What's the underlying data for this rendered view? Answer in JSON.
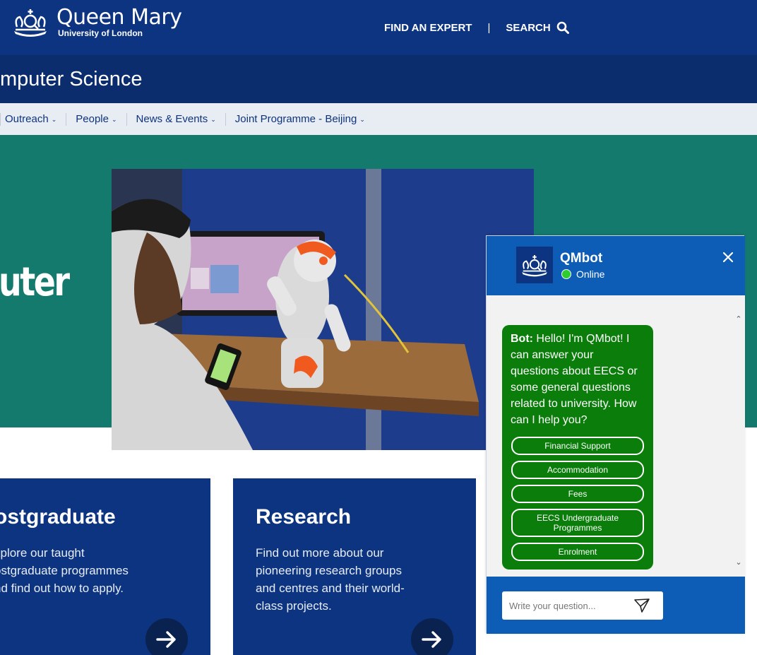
{
  "header": {
    "logo_main": "Queen Mary",
    "logo_sub": "University of London",
    "find_expert": "FIND AN EXPERT",
    "separator": "|",
    "search": "SEARCH"
  },
  "section": {
    "title": "mputer Science"
  },
  "nav": {
    "items": [
      {
        "label": "Outreach"
      },
      {
        "label": "People"
      },
      {
        "label": "News & Events"
      },
      {
        "label": "Joint Programme - Beijing"
      }
    ]
  },
  "hero": {
    "word": "uter"
  },
  "cards": [
    {
      "title": "ostgraduate",
      "lines": [
        "xplore our taught",
        "ostgraduate programmes",
        "nd find out how to apply."
      ]
    },
    {
      "title": "Research",
      "lines": [
        "Find out more about our",
        "pioneering research groups",
        "and centres and their world-",
        "class projects."
      ]
    }
  ],
  "chat": {
    "bot_name": "QMbot",
    "status": "Online",
    "message_prefix": "Bot:",
    "message": " Hello! I'm QMbot! I can answer your questions about EECS or some general questions related to university. How can I help you?",
    "options": [
      {
        "label": "Financial Support"
      },
      {
        "label": "Accommodation"
      },
      {
        "label": "Fees"
      },
      {
        "label": "EECS Undergraduate Programmes"
      },
      {
        "label": "Enrolment"
      }
    ],
    "input_placeholder": "Write your question..."
  },
  "colors": {
    "header_bg": "#0d3480",
    "section_bg": "#0b2c6d",
    "hero_bg": "#147a6e",
    "chat_header": "#0d5cb5",
    "bubble": "#0a7d0a",
    "online_dot": "#2ecc2e"
  },
  "icons": [
    "crown-crest-icon",
    "search-icon",
    "chevron-down-icon",
    "arrow-right-icon",
    "close-icon",
    "send-icon"
  ]
}
